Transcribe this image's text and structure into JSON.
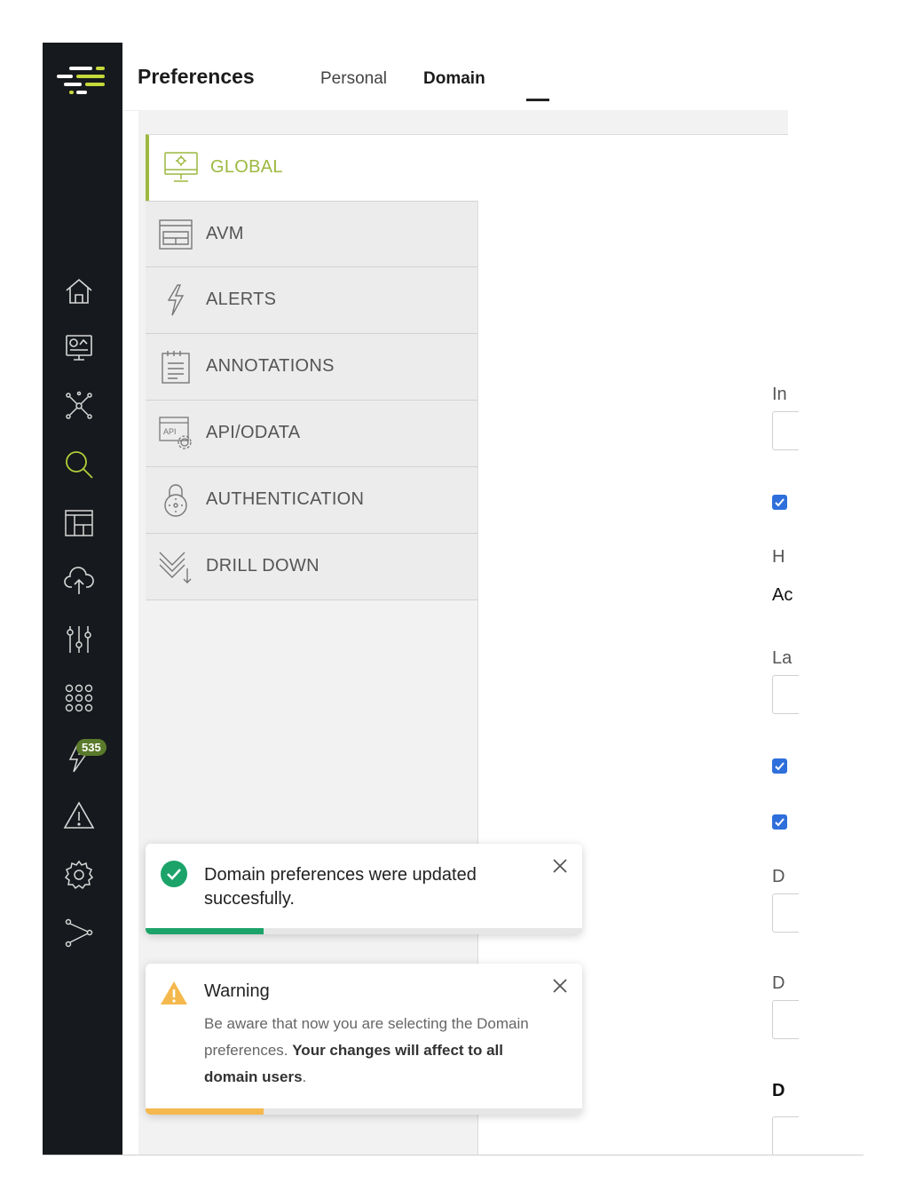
{
  "header": {
    "title": "Preferences",
    "tabs": [
      {
        "label": "Personal",
        "active": false
      },
      {
        "label": "Domain",
        "active": true
      }
    ]
  },
  "sidebar": {
    "items": [
      {
        "icon": "home-icon"
      },
      {
        "icon": "dashboard-monitor-icon"
      },
      {
        "icon": "network-topology-icon"
      },
      {
        "icon": "search-icon",
        "active": true
      },
      {
        "icon": "layout-grid-icon"
      },
      {
        "icon": "cloud-upload-icon"
      },
      {
        "icon": "sliders-icon"
      },
      {
        "icon": "apps-grid-icon"
      },
      {
        "icon": "alerts-bolt-icon",
        "badge": "535"
      },
      {
        "icon": "warning-icon"
      },
      {
        "icon": "settings-gear-icon"
      },
      {
        "icon": "share-nodes-icon"
      }
    ]
  },
  "menu": {
    "active": {
      "label": "GLOBAL",
      "icon": "monitor-gear-icon"
    },
    "items": [
      {
        "label": "AVM",
        "icon": "layout-window-icon"
      },
      {
        "label": "ALERTS",
        "icon": "lightning-icon"
      },
      {
        "label": "ANNOTATIONS",
        "icon": "notepad-icon"
      },
      {
        "label": "API/ODATA",
        "icon": "api-gear-icon"
      },
      {
        "label": "AUTHENTICATION",
        "icon": "padlock-icon"
      },
      {
        "label": "DRILL DOWN",
        "icon": "drill-down-chevrons-icon"
      }
    ]
  },
  "form_fragments": {
    "in": "In",
    "h": "H",
    "ac": "Ac",
    "la": "La",
    "d1": "D",
    "d2": "D",
    "d3": "D"
  },
  "toasts": {
    "success": {
      "message": "Domain preferences were updated succesfully.",
      "progress": 0.27,
      "color": "#1ba36a"
    },
    "warning": {
      "title": "Warning",
      "body_plain": "Be aware that now you are selecting the Domain preferences. ",
      "body_bold": "Your changes will affect to all domain users",
      "body_end": ".",
      "progress": 0.27,
      "color": "#f5b84d"
    }
  },
  "colors": {
    "sidebar": "#16191d",
    "accent": "#9cb93f",
    "checkbox": "#2e6fdb"
  }
}
